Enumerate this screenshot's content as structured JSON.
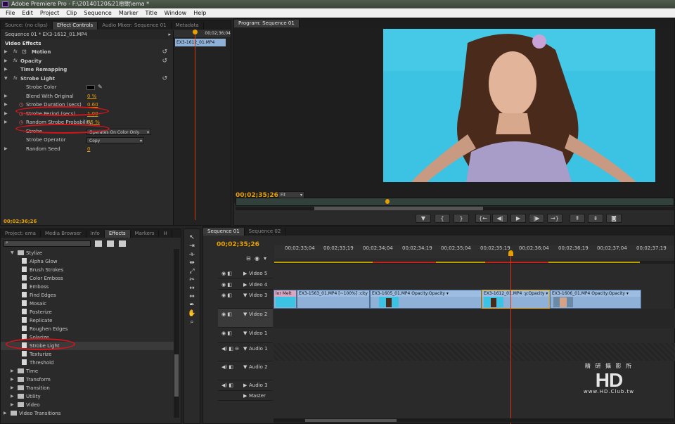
{
  "app": {
    "title": "Adobe Premiere Pro - F:\\20140120&21樹蛻\\ema *"
  },
  "menu": [
    "File",
    "Edit",
    "Project",
    "Clip",
    "Sequence",
    "Marker",
    "Title",
    "Window",
    "Help"
  ],
  "source_tabs": [
    "Source: (no clips)",
    "Effect Controls",
    "Audio Mixer: Sequence 01",
    "Metadata"
  ],
  "effect_controls": {
    "clip_header": "Sequence 01 * EX3-1612_01.MP4",
    "timecode_top": "00;02;36;04",
    "clip_name": "EX3-1612_01.MP4",
    "section": "Video Effects",
    "effects": [
      "Motion",
      "Opacity",
      "Time Remapping",
      "Strobe Light"
    ],
    "params": [
      {
        "name": "Strobe Color",
        "value": ""
      },
      {
        "name": "Blend With Original",
        "value": "0 %"
      },
      {
        "name": "Strobe Duration (secs)",
        "value": "0.60"
      },
      {
        "name": "Strobe Period (secs)",
        "value": "1.00"
      },
      {
        "name": "Random Strobe Probability",
        "value": "75 %"
      },
      {
        "name": "Strobe",
        "value": "Operates On Color Only"
      },
      {
        "name": "Strobe Operator",
        "value": "Copy"
      },
      {
        "name": "Random Seed",
        "value": "0"
      }
    ],
    "timecode": "00;02;36;26"
  },
  "program": {
    "tab": "Program: Sequence 01",
    "timecode": "00;02;35;26",
    "fit": "Fit"
  },
  "project_tabs": [
    "Project: ema",
    "Media Browser",
    "Info",
    "Effects",
    "Markers",
    "H"
  ],
  "effects_list": {
    "folder_open": "Stylize",
    "items": [
      "Alpha Glow",
      "Brush Strokes",
      "Color Emboss",
      "Emboss",
      "Find Edges",
      "Mosaic",
      "Posterize",
      "Replicate",
      "Roughen Edges",
      "Solarize",
      "Strobe Light",
      "Texturize",
      "Threshold"
    ],
    "folders": [
      "Time",
      "Transform",
      "Transition",
      "Utility",
      "Video"
    ],
    "root": "Video Transitions"
  },
  "timeline": {
    "tabs": [
      "Sequence 01",
      "Sequence 02"
    ],
    "timecode": "00;02;35;26",
    "ruler": [
      "00;02;33;04",
      "00;02;33;19",
      "00;02;34;04",
      "00;02;34;19",
      "00;02;35;04",
      "00;02;35;19",
      "00;02;36;04",
      "00;02;36;19",
      "00;02;37;04",
      "00;02;37;19"
    ],
    "tracks": [
      "Video 5",
      "Video 4",
      "Video 3",
      "Video 2",
      "Video 1",
      "Audio 1",
      "Audio 2",
      "Audio 3",
      "Master"
    ],
    "clips": [
      {
        "label": "lor Melt"
      },
      {
        "label": "EX3-1563_01.MP4 [~100%]  :city ▾"
      },
      {
        "label": "EX3-1605_01.MP4  Opacity:Opacity ▾"
      },
      {
        "label": "EX3-1612_01.MP4  :y:Opacity ▾"
      },
      {
        "label": "EX3-1606_01.MP4  Opacity:Opacity ▾"
      }
    ]
  },
  "watermark": {
    "cn": "精 研 攝 影 所",
    "logo": "HD CLUB",
    "url": "www.HD.Club.tw"
  },
  "colors": {
    "accent": "#e8a000",
    "annotation": "#d2141b",
    "clip": "#8fb1d8",
    "playhead": "#d23a14",
    "sky": "#3cc2e2"
  }
}
